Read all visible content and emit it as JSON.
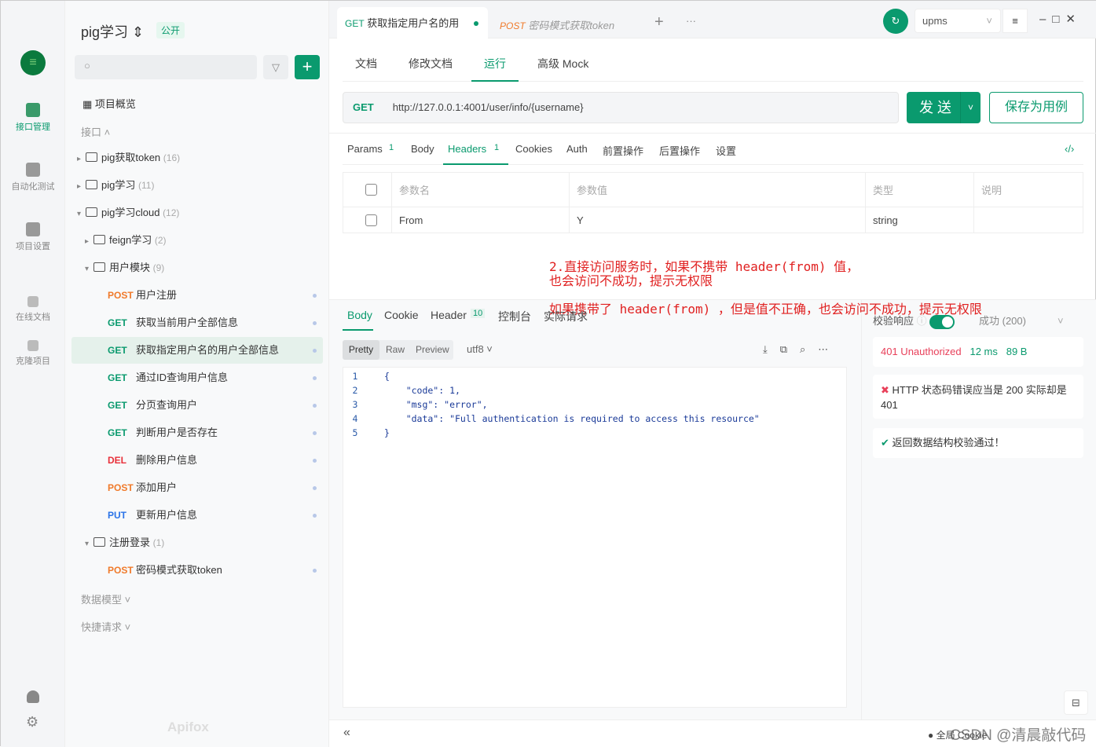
{
  "rail": {
    "items": [
      {
        "label": "接口管理"
      },
      {
        "label": "自动化测试"
      },
      {
        "label": "项目设置"
      },
      {
        "label": "在线文档"
      },
      {
        "label": "克隆项目"
      }
    ],
    "brand": "Apifox"
  },
  "project": {
    "name": "pig学习",
    "visibility": "公开"
  },
  "sidebar": {
    "overview": "项目概览",
    "section": "接口",
    "data_models": "数据模型",
    "quick": "快捷请求",
    "tree": [
      {
        "type": "folder",
        "label": "pig获取token",
        "count": "(16)"
      },
      {
        "type": "folder",
        "label": "pig学习",
        "count": "(11)"
      },
      {
        "type": "folder",
        "label": "pig学习cloud",
        "count": "(12)"
      },
      {
        "type": "folder",
        "label": "feign学习",
        "count": "(2)"
      },
      {
        "type": "folder",
        "label": "用户模块",
        "count": "(9)"
      },
      {
        "type": "api",
        "method": "POST",
        "label": "用户注册"
      },
      {
        "type": "api",
        "method": "GET",
        "label": "获取当前用户全部信息"
      },
      {
        "type": "api",
        "method": "GET",
        "label": "获取指定用户名的用户全部信息"
      },
      {
        "type": "api",
        "method": "GET",
        "label": "通过ID查询用户信息"
      },
      {
        "type": "api",
        "method": "GET",
        "label": "分页查询用户"
      },
      {
        "type": "api",
        "method": "GET",
        "label": "判断用户是否存在"
      },
      {
        "type": "api",
        "method": "DEL",
        "label": "删除用户信息"
      },
      {
        "type": "api",
        "method": "POST",
        "label": "添加用户"
      },
      {
        "type": "api",
        "method": "PUT",
        "label": "更新用户信息"
      },
      {
        "type": "folder",
        "label": "注册登录",
        "count": "(1)"
      },
      {
        "type": "api",
        "method": "POST",
        "label": "密码模式获取token"
      }
    ]
  },
  "tabs": [
    {
      "method": "GET",
      "label": "获取指定用户名的用"
    },
    {
      "method": "POST",
      "label": "密码模式获取token"
    }
  ],
  "env": "upms",
  "subtabs": [
    "文档",
    "修改文档",
    "运行",
    "高级 Mock"
  ],
  "request": {
    "method": "GET",
    "url": "http://127.0.0.1:4001/user/info/{username}",
    "send": "发 送",
    "save": "保存为用例"
  },
  "param_tabs": {
    "params": "Params",
    "params_count": "1",
    "body": "Body",
    "headers": "Headers",
    "headers_count": "1",
    "cookies": "Cookies",
    "auth": "Auth",
    "pre": "前置操作",
    "post": "后置操作",
    "settings": "设置"
  },
  "headers_table": {
    "columns": [
      "参数名",
      "参数值",
      "类型",
      "说明"
    ],
    "rows": [
      {
        "name": "From",
        "value": "Y",
        "type": "string",
        "desc": ""
      }
    ]
  },
  "annotation": {
    "line1": "2.直接访问服务时，如果不携带 header(from) 值，",
    "line2": "也会访问不成功，提示无权限",
    "line3": "如果携带了 header(from) ，但是值不正确，也会访问不成功，提示无权限"
  },
  "response": {
    "tabs": {
      "body": "Body",
      "cookie": "Cookie",
      "header": "Header",
      "header_count": "10",
      "console": "控制台",
      "actual": "实际请求"
    },
    "formats": [
      "Pretty",
      "Raw",
      "Preview"
    ],
    "encoding": "utf8",
    "code_lines": [
      "{",
      "    \"code\": 1,",
      "    \"msg\": \"error\",",
      "    \"data\": \"Full authentication is required to access this resource\"",
      "}"
    ],
    "validate_label": "校验响应",
    "validate_status": "成功 (200)",
    "status": "401 Unauthorized",
    "time": "12 ms",
    "size": "89 B",
    "error": "HTTP 状态码错误应当是 200 实际却是 401",
    "ok": "返回数据结构校验通过！"
  },
  "footer": {
    "cookie": "全局 Cookie",
    "watermark": "CSDN @清晨敲代码"
  }
}
